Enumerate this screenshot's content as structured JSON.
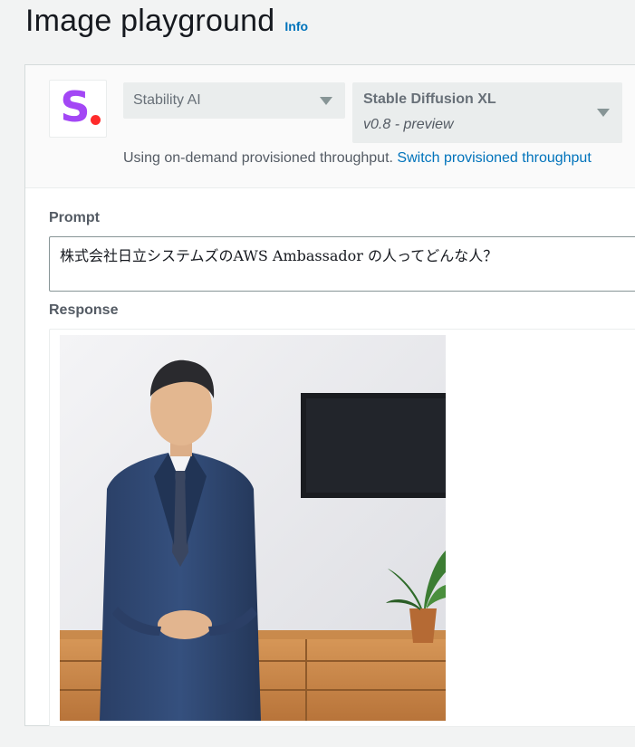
{
  "header": {
    "title": "Image playground",
    "info_label": "Info"
  },
  "model_selector": {
    "provider": "Stability AI",
    "model_name": "Stable Diffusion XL",
    "model_version": "v0.8 - preview",
    "logo_letter": "S",
    "logo_colors": {
      "letter": "#a347f5",
      "dot": "#ff2b2b"
    }
  },
  "throughput": {
    "text": "Using on-demand provisioned throughput. ",
    "link": "Switch provisioned throughput"
  },
  "prompt": {
    "label": "Prompt",
    "value": "株式会社日立システムズのAWS Ambassador の人ってどんな人？"
  },
  "response": {
    "label": "Response"
  },
  "colors": {
    "accent_link": "#0073bb",
    "background": "#f2f3f3"
  }
}
